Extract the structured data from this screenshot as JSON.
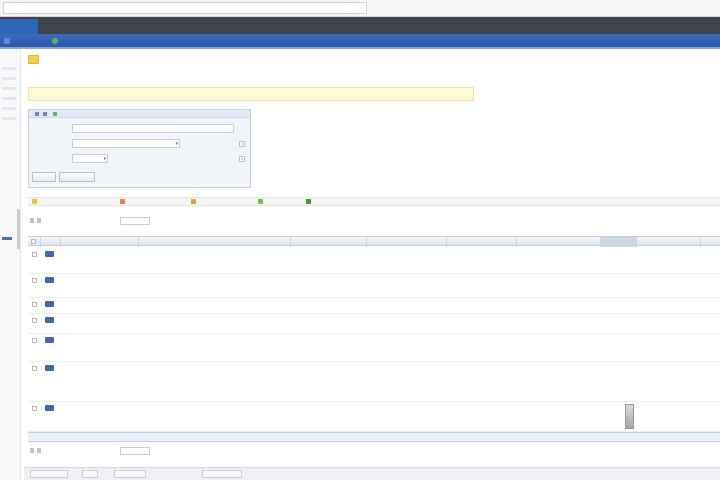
{
  "browser": {
    "address": ""
  },
  "app": {
    "tab_title": ""
  },
  "navbar": {
    "items": [
      {
        "label": "",
        "icon": "home-icon",
        "color": "#5b8ee0"
      },
      {
        "label": "",
        "icon": "leaf-icon",
        "color": "#5cb85c"
      }
    ]
  },
  "page": {
    "title": "",
    "breadcrumbs": ""
  },
  "notice": {
    "text": "",
    "link": ""
  },
  "filter": {
    "header": "",
    "rows": [
      {
        "label": "",
        "value": ""
      },
      {
        "label": "",
        "value": ""
      },
      {
        "label": "",
        "value": ""
      }
    ],
    "apply_label": "",
    "reset_label": ""
  },
  "toolbar": {
    "items": [
      {
        "label": "",
        "icon": "star-icon",
        "color": "#e7c43a"
      },
      {
        "label": "",
        "icon": "delete-icon",
        "color": "#e08a4a"
      },
      {
        "label": "",
        "icon": "move-icon",
        "color": "#e0a34a"
      },
      {
        "label": "",
        "icon": "export-icon",
        "color": "#7bbf4e"
      },
      {
        "label": "",
        "icon": "excel-icon",
        "color": "#3e9a3e"
      }
    ]
  },
  "pager": {
    "text": "",
    "page_size": ""
  },
  "grid": {
    "columns": [
      "",
      "",
      "",
      "",
      "",
      "",
      "",
      "",
      "",
      ""
    ],
    "rows": [
      {
        "title": "",
        "c1": "",
        "c2": "",
        "c3": "",
        "c4": "",
        "c5": ""
      },
      {
        "title": "",
        "c1": "",
        "c2": "",
        "c3": "",
        "c4": "",
        "c5": ""
      },
      {
        "title": "",
        "c1": "",
        "c2": "",
        "c3": "",
        "c4": "",
        "c5": ""
      },
      {
        "title": "",
        "c1": "",
        "c2": "",
        "c3": "",
        "c4": "",
        "c5": ""
      },
      {
        "title": "",
        "c1": "",
        "c2": "",
        "c3": "",
        "c4": "",
        "c5": ""
      },
      {
        "title": "",
        "c1": "",
        "c2": "",
        "c3": "",
        "c4": "",
        "c5": ""
      },
      {
        "title": "",
        "c1": "",
        "c2": "",
        "c3": "",
        "c4": "",
        "c5": ""
      }
    ],
    "footer": ""
  },
  "status": {
    "items": [
      "",
      "",
      "",
      ""
    ]
  }
}
